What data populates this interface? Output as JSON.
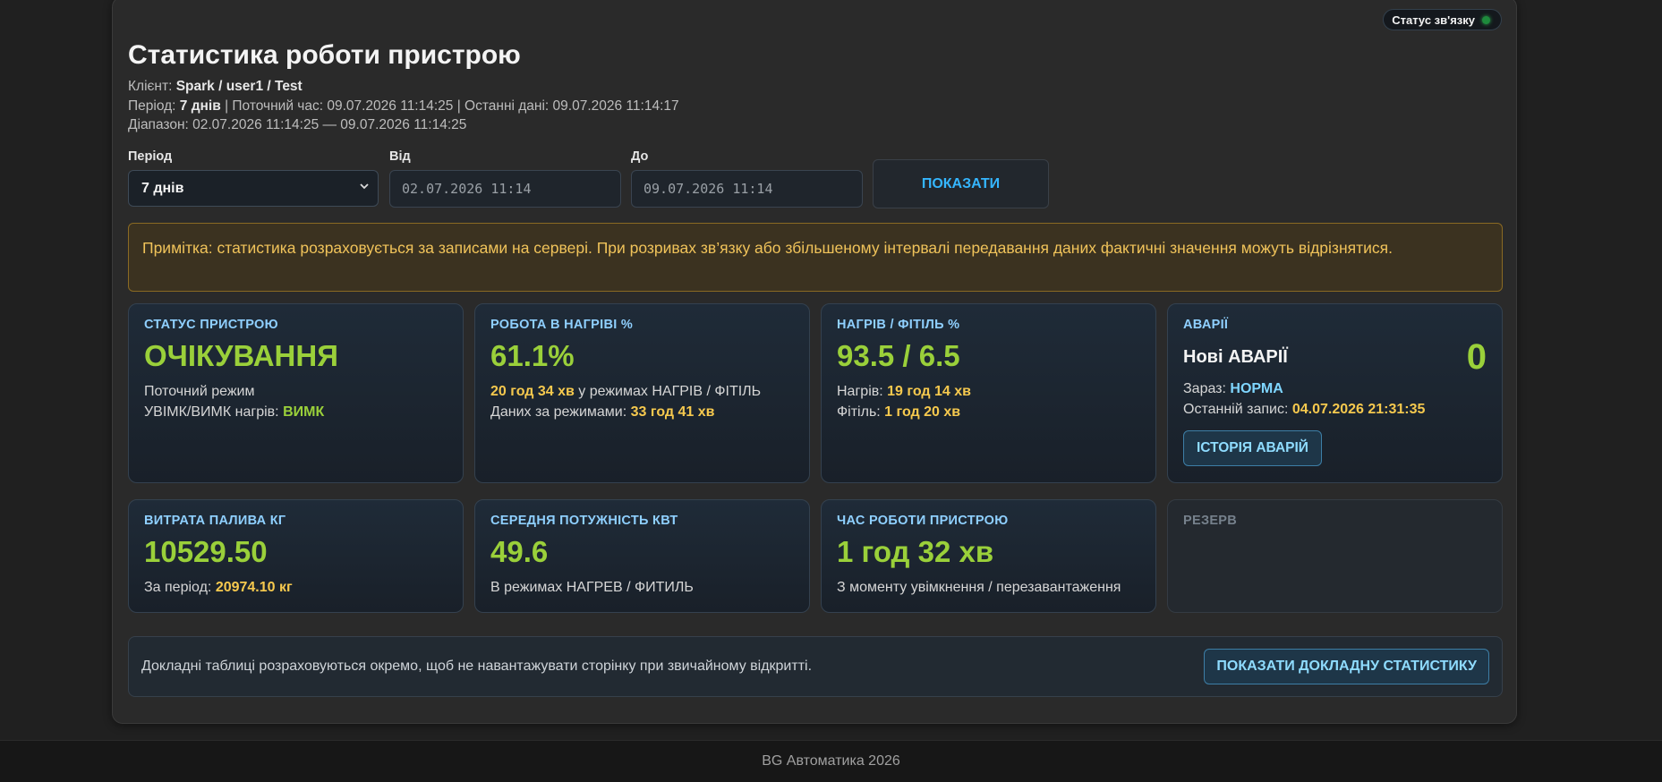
{
  "connection": {
    "label": "Статус зв'язку"
  },
  "header": {
    "title": "Статистика роботи пристрою",
    "client_label": "Клієнт:",
    "client_value": "Spark / user1 / Test",
    "period_label": "Період:",
    "period_value": "7 днів",
    "current_time": "| Поточний час: 09.07.2026 11:14:25 | Останні дані: 09.07.2026 11:14:17",
    "range": "Діапазон: 02.07.2026 11:14:25 — 09.07.2026 11:14:25"
  },
  "filters": {
    "period_label": "Період",
    "period_selected": "7 днів",
    "from_label": "Від",
    "from_value": "02.07.2026 11:14",
    "to_label": "До",
    "to_value": "09.07.2026 11:14",
    "show_button": "ПОКАЗАТИ"
  },
  "note": "Примітка: статистика розраховується за записами на сервері. При розривах зв’язку або збільшеному інтервалі передавання даних фактичні значення можуть відрізнятися.",
  "cards": {
    "status": {
      "title": "СТАТУС ПРИСТРОЮ",
      "value": "ОЧІКУВАННЯ",
      "line1": "Поточний режим",
      "line2_label": "УВІМК/ВИМК нагрів:",
      "line2_value": "ВИМК"
    },
    "heating": {
      "title": "РОБОТА В НАГРІВІ %",
      "value": "61.1%",
      "line1_value": "20 год 34 хв",
      "line1_text": " у режимах НАГРІВ / ФІТІЛЬ",
      "line2_label": "Даних за режимами:",
      "line2_value": "33 год 41 хв"
    },
    "heat_wick": {
      "title": "НАГРІВ / ФІТІЛЬ %",
      "value": "93.5 / 6.5",
      "line1_label": "Нагрів:",
      "line1_value": "19 год 14 хв",
      "line2_label": "Фітіль:",
      "line2_value": "1 год 20 хв"
    },
    "alarms": {
      "title": "АВАРІЇ",
      "new_label": "Нові АВАРІЇ",
      "count": "0",
      "now_label": "Зараз:",
      "now_value": "НОРМА",
      "last_label": "Останній запис:",
      "last_value": "04.07.2026 21:31:35",
      "history_button": "ІСТОРІЯ АВАРІЙ"
    },
    "fuel": {
      "title": "ВИТРАТА ПАЛИВА КГ",
      "value": "10529.50",
      "line1_label": "За період:",
      "line1_value": "20974.10 кг"
    },
    "power": {
      "title": "СЕРЕДНЯ ПОТУЖНІСТЬ КВТ",
      "value": "49.6",
      "line1": "В режимах НАГРЕВ / ФИТИЛЬ"
    },
    "uptime": {
      "title": "ЧАС РОБОТИ ПРИСТРОЮ",
      "value": "1 год 32 хв",
      "line1": "З моменту увімкнення / перезавантаження"
    },
    "reserve": {
      "title": "РЕЗЕРВ"
    }
  },
  "details": {
    "text": "Докладні таблиці розраховуються окремо, щоб не навантажувати сторінку при звичайному відкритті.",
    "button": "ПОКАЗАТИ ДОКЛАДНУ СТАТИСТИКУ"
  },
  "footer": "BG Автоматика 2026",
  "icons": {
    "status_dot": "status-dot-icon",
    "select_arrow": "chevron-down-icon"
  },
  "colors": {
    "accent_green": "#9ad03a",
    "accent_yellow": "#f6c94e",
    "accent_blue": "#35b6ff",
    "status_ok": "#1e8a3c"
  }
}
